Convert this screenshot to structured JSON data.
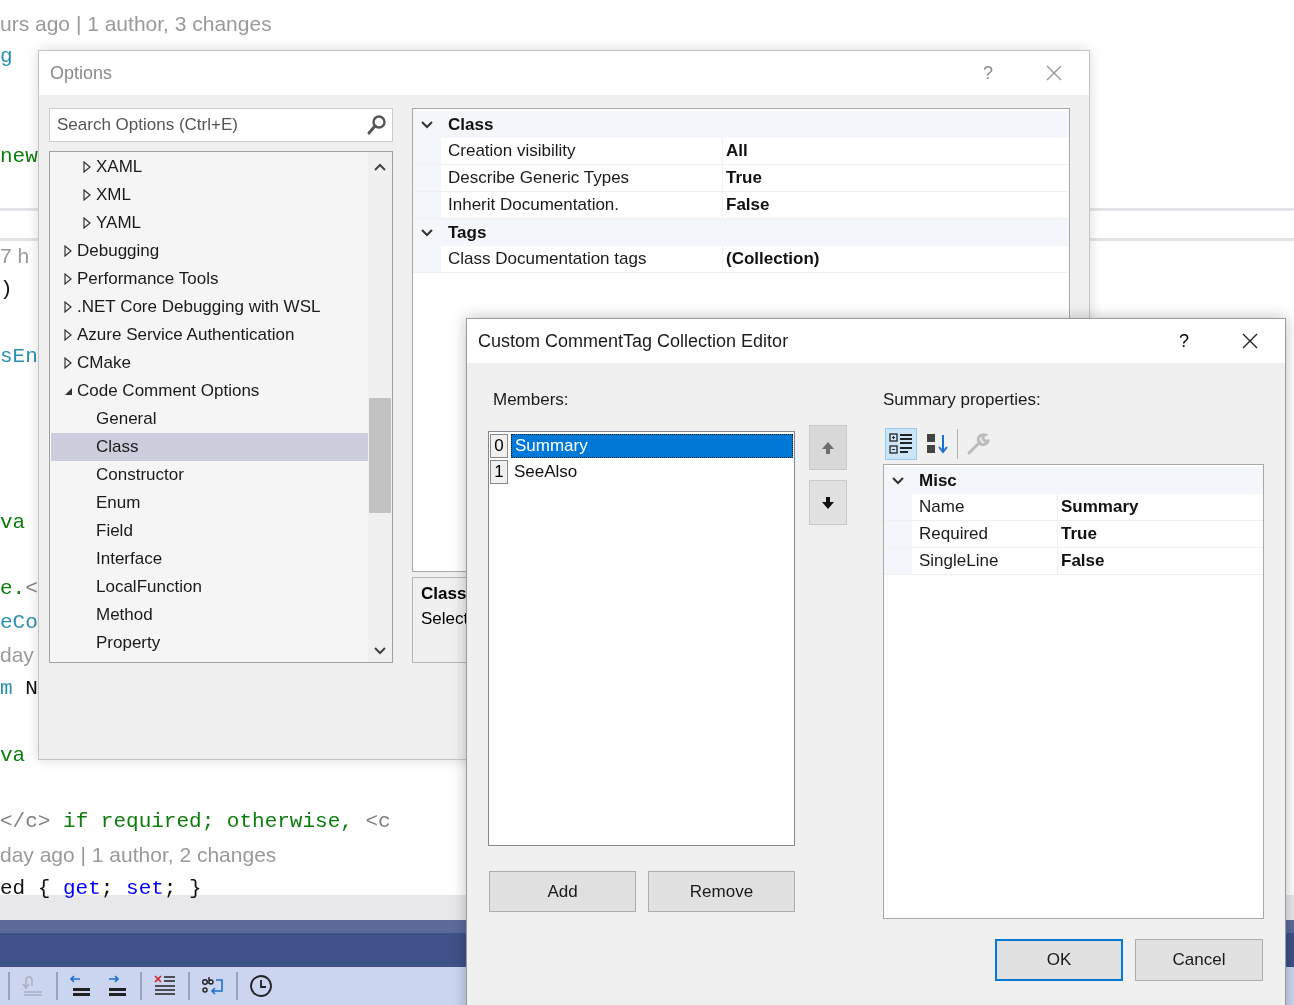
{
  "editor": {
    "code_lines": [
      {
        "segments": [
          {
            "kind": "lens",
            "text": "urs ago | 1 author, 3 changes"
          }
        ]
      },
      {
        "segments": [
          {
            "kind": "type",
            "text": "g"
          }
        ]
      },
      {
        "segments": [
          {
            "kind": "comment",
            "text": "new"
          }
        ]
      },
      {
        "segments": [
          {
            "kind": "lens",
            "text": "7 h"
          }
        ]
      },
      {
        "segments": [
          {
            "kind": "plain",
            "text": ")"
          }
        ]
      },
      {
        "segments": [
          {
            "kind": "type",
            "text": "sEn"
          }
        ]
      },
      {
        "segments": [
          {
            "kind": "comment",
            "text": "va"
          }
        ]
      },
      {
        "segments": [
          {
            "kind": "comment",
            "text": "e."
          },
          {
            "kind": "doctag",
            "text": "<"
          }
        ]
      },
      {
        "segments": [
          {
            "kind": "type",
            "text": "eCo"
          }
        ]
      },
      {
        "segments": [
          {
            "kind": "lens",
            "text": "day"
          }
        ]
      },
      {
        "segments": [
          {
            "kind": "type",
            "text": "m"
          },
          {
            "kind": "plain",
            "text": " N"
          }
        ]
      },
      {
        "segments": [
          {
            "kind": "comment",
            "text": "va"
          }
        ]
      },
      {
        "segments": [
          {
            "kind": "doctag",
            "text": "</c>"
          },
          {
            "kind": "comment",
            "text": " if required; otherwise, "
          },
          {
            "kind": "doctag",
            "text": "<c"
          }
        ]
      },
      {
        "segments": [
          {
            "kind": "lens",
            "text": "day ago | 1 author, 2 changes"
          }
        ]
      },
      {
        "segments": [
          {
            "kind": "plain",
            "text": "ed { "
          },
          {
            "kind": "keyword",
            "text": "get"
          },
          {
            "kind": "plain",
            "text": "; "
          },
          {
            "kind": "keyword",
            "text": "set"
          },
          {
            "kind": "plain",
            "text": "; }"
          }
        ]
      }
    ]
  },
  "options_dialog": {
    "title": "Options",
    "help": "?",
    "search": {
      "placeholder": "Search Options (Ctrl+E)"
    },
    "tree": [
      {
        "children": [
          {
            "label": "XAML",
            "expanded": false,
            "selected": false
          },
          {
            "label": "XML",
            "expanded": false,
            "selected": false
          },
          {
            "label": "YAML",
            "expanded": false,
            "selected": false
          }
        ]
      },
      {
        "label": "Debugging",
        "expanded": false,
        "selected": false
      },
      {
        "label": "Performance Tools",
        "expanded": false,
        "selected": false
      },
      {
        "label": ".NET Core Debugging with WSL",
        "expanded": false,
        "selected": false
      },
      {
        "label": "Azure Service Authentication",
        "expanded": false,
        "selected": false
      },
      {
        "label": "CMake",
        "expanded": false,
        "selected": false
      },
      {
        "label": "Code Comment Options",
        "expanded": true,
        "selected": false,
        "children": [
          {
            "label": "General",
            "selected": false
          },
          {
            "label": "Class",
            "selected": true
          },
          {
            "label": "Constructor",
            "selected": false
          },
          {
            "label": "Enum",
            "selected": false
          },
          {
            "label": "Field",
            "selected": false
          },
          {
            "label": "Interface",
            "selected": false
          },
          {
            "label": "LocalFunction",
            "selected": false
          },
          {
            "label": "Method",
            "selected": false
          },
          {
            "label": "Property",
            "selected": false
          }
        ]
      }
    ],
    "property_grid": {
      "categories": [
        {
          "name": "Class",
          "expanded": true,
          "rows": [
            {
              "name": "Creation visibility",
              "value": "All"
            },
            {
              "name": "Describe Generic Types",
              "value": "True"
            },
            {
              "name": "Inherit Documentation.",
              "value": "False"
            }
          ]
        },
        {
          "name": "Tags",
          "expanded": true,
          "rows": [
            {
              "name": "Class Documentation tags",
              "value": "(Collection)"
            }
          ]
        }
      ]
    },
    "description": {
      "title": "Class",
      "text": "Select"
    }
  },
  "collection_editor": {
    "title": "Custom CommentTag Collection Editor",
    "help": "?",
    "members_label": "Members:",
    "members": [
      {
        "index": "0",
        "name": "Summary",
        "selected": true
      },
      {
        "index": "1",
        "name": "SeeAlso",
        "selected": false
      }
    ],
    "move_buttons": [
      {
        "kind": "up",
        "disabled": true
      },
      {
        "kind": "down",
        "disabled": false
      }
    ],
    "list_buttons": [
      {
        "label": "Add"
      },
      {
        "label": "Remove"
      }
    ],
    "properties_label": "Summary properties:",
    "tools": [
      {
        "kind": "categorized",
        "selected": true,
        "disabled": false
      },
      {
        "kind": "alphabetical",
        "selected": false,
        "disabled": false
      },
      {
        "kind": "property-pages",
        "selected": false,
        "disabled": true
      }
    ],
    "property_grid": {
      "categories": [
        {
          "name": "Misc",
          "expanded": true,
          "rows": [
            {
              "name": "Name",
              "value": "Summary"
            },
            {
              "name": "Required",
              "value": "True"
            },
            {
              "name": "SingleLine",
              "value": "False"
            }
          ]
        }
      ]
    },
    "dialog_buttons": [
      {
        "label": "OK",
        "default": true
      },
      {
        "label": "Cancel",
        "default": false
      }
    ]
  }
}
